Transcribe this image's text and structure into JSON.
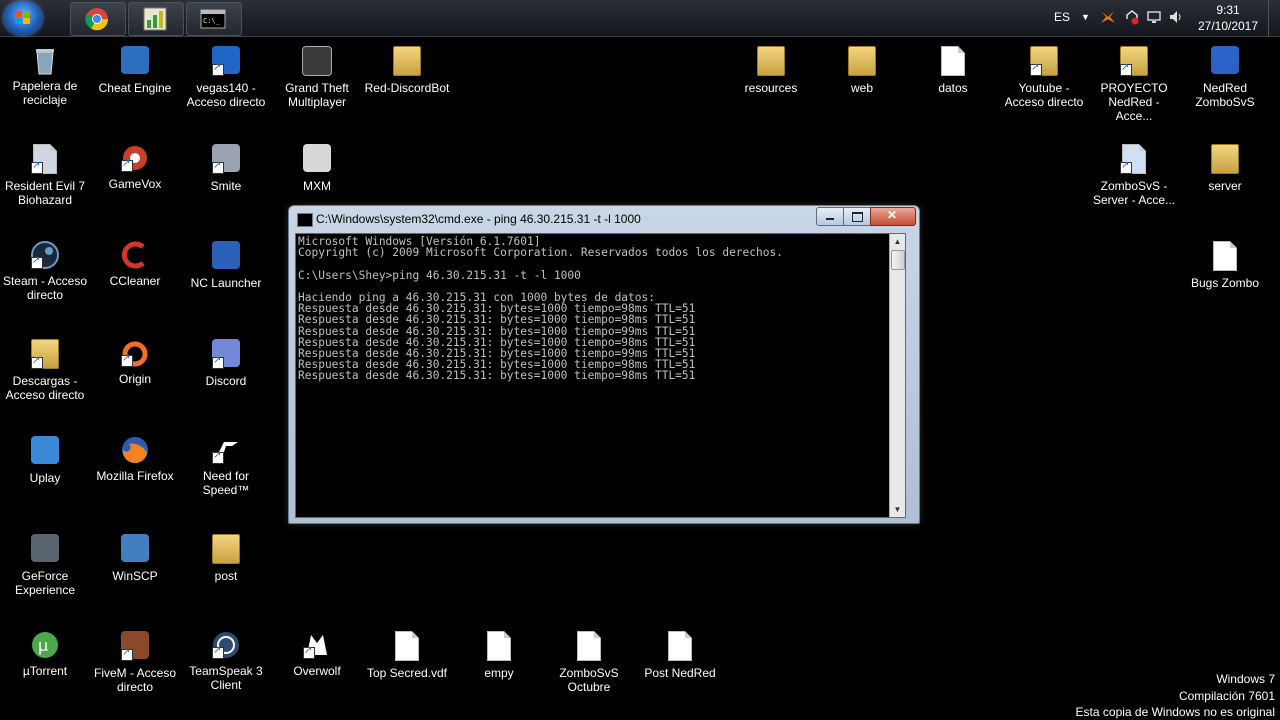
{
  "taskbar": {
    "buttons": [
      {
        "name": "chrome",
        "icon": "chrome-icon"
      },
      {
        "name": "chart-app",
        "icon": "chart-app-icon"
      },
      {
        "name": "cmd",
        "icon": "cmd-icon"
      }
    ],
    "language": "ES",
    "time": "9:31",
    "date": "27/10/2017"
  },
  "desktop_icons": {
    "papelera": "Papelera de reciclaje",
    "cheat_engine": "Cheat Engine",
    "vegas": "vegas140 - Acceso directo",
    "gta": "Grand Theft Multiplayer",
    "red_discord": "Red-DiscordBot",
    "resources": "resources",
    "web": "web",
    "datos": "datos",
    "youtube": "Youtube - Acceso directo",
    "proyecto": "PROYECTO NedRed - Acce...",
    "nedred_zombo": "NedRed ZomboSvS",
    "resident": "Resident Evil 7 Biohazard",
    "gamevox": "GameVox",
    "smite": "Smite",
    "mxm": "MXM",
    "zombo_server": "ZomboSvS - Server - Acce...",
    "server": "server",
    "steam": "Steam - Acceso directo",
    "ccleaner": "CCleaner",
    "nc_launcher": "NC Launcher",
    "bugs_zombo": "Bugs Zombo",
    "descargas": "Descargas - Acceso directo",
    "origin": "Origin",
    "discord": "Discord",
    "uplay": "Uplay",
    "firefox": "Mozilla Firefox",
    "nfs": "Need for Speed™",
    "geforce": "GeForce Experience",
    "winscp": "WinSCP",
    "post": "post",
    "utorrent": "µTorrent",
    "fivem": "FiveM - Acceso directo",
    "teamspeak": "TeamSpeak 3 Client",
    "overwolf": "Overwolf",
    "top_secred": "Top Secred.vdf",
    "empy": "empy",
    "zombo_octubre": "ZomboSvS Octubre",
    "post_nedred": "Post NedRed"
  },
  "cmd_window": {
    "title": "C:\\Windows\\system32\\cmd.exe - ping  46.30.215.31 -t -l 1000",
    "lines": [
      "Microsoft Windows [Versión 6.1.7601]",
      "Copyright (c) 2009 Microsoft Corporation. Reservados todos los derechos.",
      "",
      "C:\\Users\\Shey>ping 46.30.215.31 -t -l 1000",
      "",
      "Haciendo ping a 46.30.215.31 con 1000 bytes de datos:",
      "Respuesta desde 46.30.215.31: bytes=1000 tiempo=98ms TTL=51",
      "Respuesta desde 46.30.215.31: bytes=1000 tiempo=98ms TTL=51",
      "Respuesta desde 46.30.215.31: bytes=1000 tiempo=99ms TTL=51",
      "Respuesta desde 46.30.215.31: bytes=1000 tiempo=98ms TTL=51",
      "Respuesta desde 46.30.215.31: bytes=1000 tiempo=99ms TTL=51",
      "Respuesta desde 46.30.215.31: bytes=1000 tiempo=98ms TTL=51",
      "Respuesta desde 46.30.215.31: bytes=1000 tiempo=98ms TTL=51"
    ]
  },
  "watermark": {
    "line1": "Windows 7",
    "line2": "Compilación  7601",
    "line3": "Esta copia de Windows no es original"
  }
}
